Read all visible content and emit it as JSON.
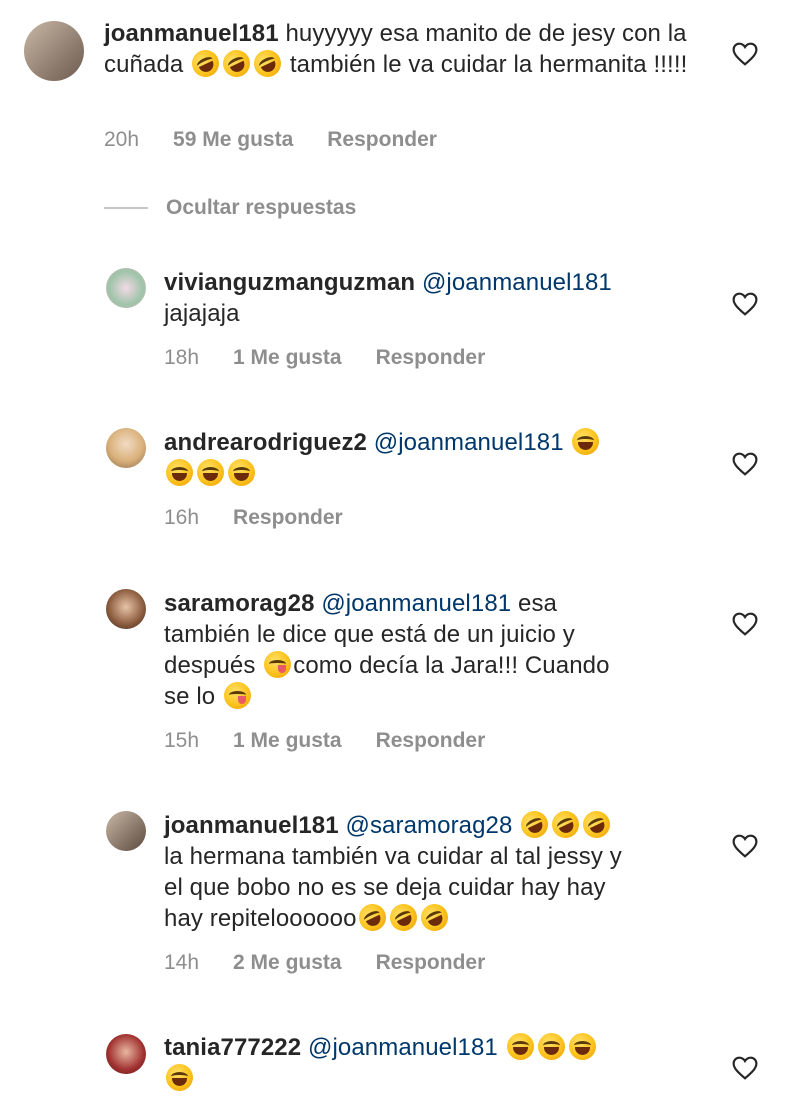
{
  "comments": [
    {
      "user": "joanmanuel181",
      "mention": "",
      "parts": [
        "huyyyyy esa manito de de jesy con la cuñada",
        "también le va cuidar la",
        "hermanita !!!!!"
      ],
      "time": "20h",
      "likes": "59 Me gusta",
      "reply": "Responder"
    },
    {
      "user": "vivianguzmanguzman",
      "mention": "@joanmanuel181",
      "parts": [
        "jajajaja"
      ],
      "time": "18h",
      "likes": "1 Me gusta",
      "reply": "Responder"
    },
    {
      "user": "andrearodriguez2",
      "mention": "@joanmanuel181",
      "parts": [],
      "time": "16h",
      "likes": "",
      "reply": "Responder"
    },
    {
      "user": "saramorag28",
      "mention": "@joanmanuel181",
      "parts": [
        "esa",
        "también le dice que está de un juicio y",
        "después",
        "como decía la Jara!!! Cuando",
        "se lo"
      ],
      "time": "15h",
      "likes": "1 Me gusta",
      "reply": "Responder"
    },
    {
      "user": "joanmanuel181",
      "mention": "@saramorag28",
      "parts": [
        "la hermana también va cuidar al tal jessy y",
        "el que bobo no es se deja cuidar hay hay",
        "hay repiteloooooo"
      ],
      "time": "14h",
      "likes": "2 Me gusta",
      "reply": "Responder"
    },
    {
      "user": "tania777222",
      "mention": "@joanmanuel181",
      "parts": [],
      "time": "",
      "likes": "",
      "reply": ""
    }
  ],
  "hide_replies": "Ocultar respuestas",
  "icons": {
    "heart": "heart-outline-icon",
    "rofl_emoji": "rolling-on-floor-laughing-emoji",
    "joy_emoji": "face-with-tears-of-joy-emoji",
    "yum_emoji": "face-savoring-food-emoji"
  },
  "colors": {
    "text": "#262626",
    "mention": "#00376b",
    "secondary": "#8e8e8e"
  }
}
